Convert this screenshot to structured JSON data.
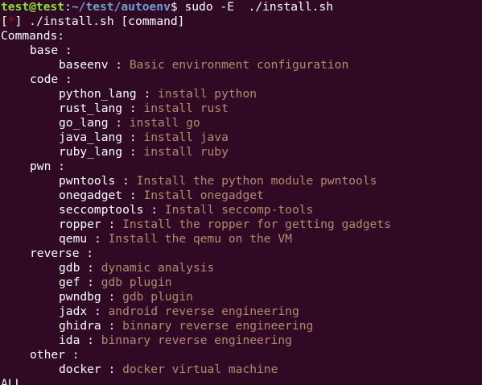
{
  "prompt": {
    "user_host": "test@test",
    "colon": ":",
    "path": "~/test/autoenv",
    "symbol": "$",
    "command": " sudo -E  ./install.sh"
  },
  "banner": {
    "open": "[",
    "star": "*",
    "close": "]",
    "text": " ./install.sh [command]"
  },
  "heading": "Commands:",
  "separator": " : ",
  "groups": [
    {
      "name": "base :",
      "items": [
        {
          "cmd": "baseenv",
          "desc": "Basic environment configuration"
        }
      ]
    },
    {
      "name": "code :",
      "items": [
        {
          "cmd": "python_lang",
          "desc": "install python"
        },
        {
          "cmd": "rust_lang",
          "desc": "install rust"
        },
        {
          "cmd": "go_lang",
          "desc": "install go"
        },
        {
          "cmd": "java_lang",
          "desc": "install java"
        },
        {
          "cmd": "ruby_lang",
          "desc": "install ruby"
        }
      ]
    },
    {
      "name": "pwn :",
      "items": [
        {
          "cmd": "pwntools",
          "desc": "Install the python module pwntools"
        },
        {
          "cmd": "onegadget",
          "desc": "Install onegadget"
        },
        {
          "cmd": "seccomptools",
          "desc": "Install seccomp-tools"
        },
        {
          "cmd": "ropper",
          "desc": "Install the ropper for getting gadgets"
        },
        {
          "cmd": "qemu",
          "desc": "Install the qemu on the VM"
        }
      ]
    },
    {
      "name": "reverse :",
      "items": [
        {
          "cmd": "gdb",
          "desc": "dynamic analysis"
        },
        {
          "cmd": "gef",
          "desc": "gdb plugin"
        },
        {
          "cmd": "pwndbg",
          "desc": "gdb plugin"
        },
        {
          "cmd": "jadx",
          "desc": "android reverse engineering"
        },
        {
          "cmd": "ghidra",
          "desc": "binnary reverse engineering"
        },
        {
          "cmd": "ida",
          "desc": "binnary reverse engineering"
        }
      ]
    },
    {
      "name": "other :",
      "items": [
        {
          "cmd": "docker",
          "desc": "docker virtual machine"
        }
      ]
    }
  ],
  "trailing": "ALL",
  "colors": {
    "background": "#300a24",
    "prompt_user": "#8ae234",
    "prompt_path": "#729fcf",
    "star": "#cc0000",
    "description": "#b5896d",
    "text": "#ffffff"
  }
}
